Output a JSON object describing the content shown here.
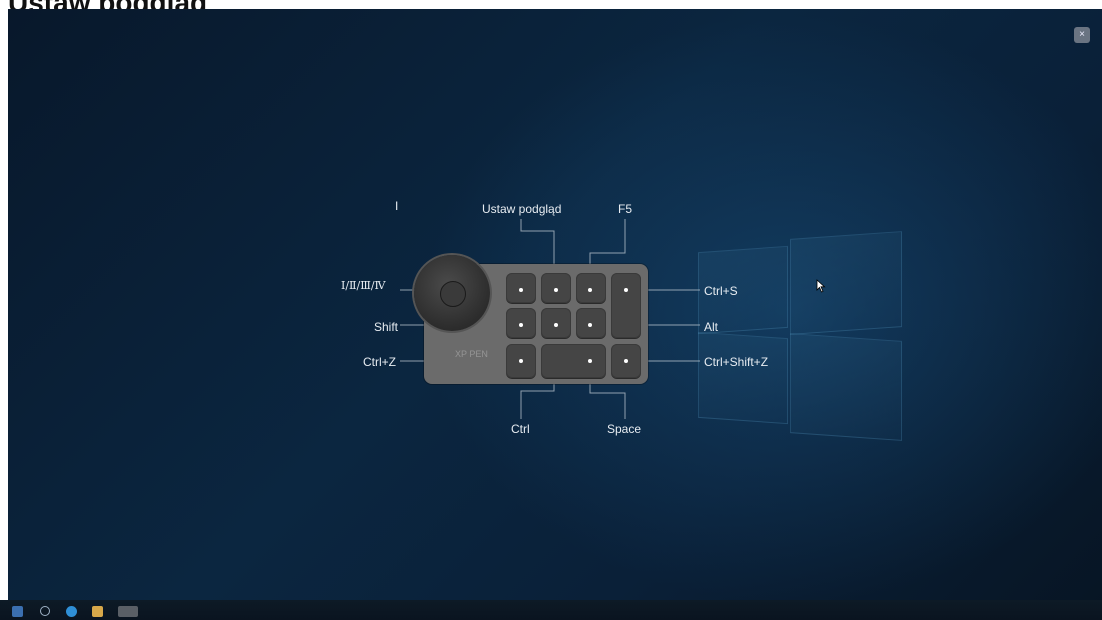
{
  "page": {
    "title": "Ustaw podgląd"
  },
  "window": {
    "close_label": "×"
  },
  "labels": {
    "top_small": "I",
    "top_preview": "Ustaw podgląd",
    "top_f5": "F5",
    "dial": "Ⅰ/Ⅱ/Ⅲ/Ⅳ",
    "shift": "Shift",
    "ctrl_z": "Ctrl+Z",
    "ctrl_s": "Ctrl+S",
    "alt": "Alt",
    "ctrl_shift_z": "Ctrl+Shift+Z",
    "ctrl": "Ctrl",
    "space": "Space"
  },
  "device": {
    "brand": "XP PEN"
  },
  "colors": {
    "background": "#0b2640",
    "device": "#6b6b6b",
    "key": "#454545",
    "label": "#e8edf2"
  },
  "icons": [
    "close-icon",
    "windows-logo-icon",
    "mouse-cursor-icon",
    "dial-icon"
  ]
}
